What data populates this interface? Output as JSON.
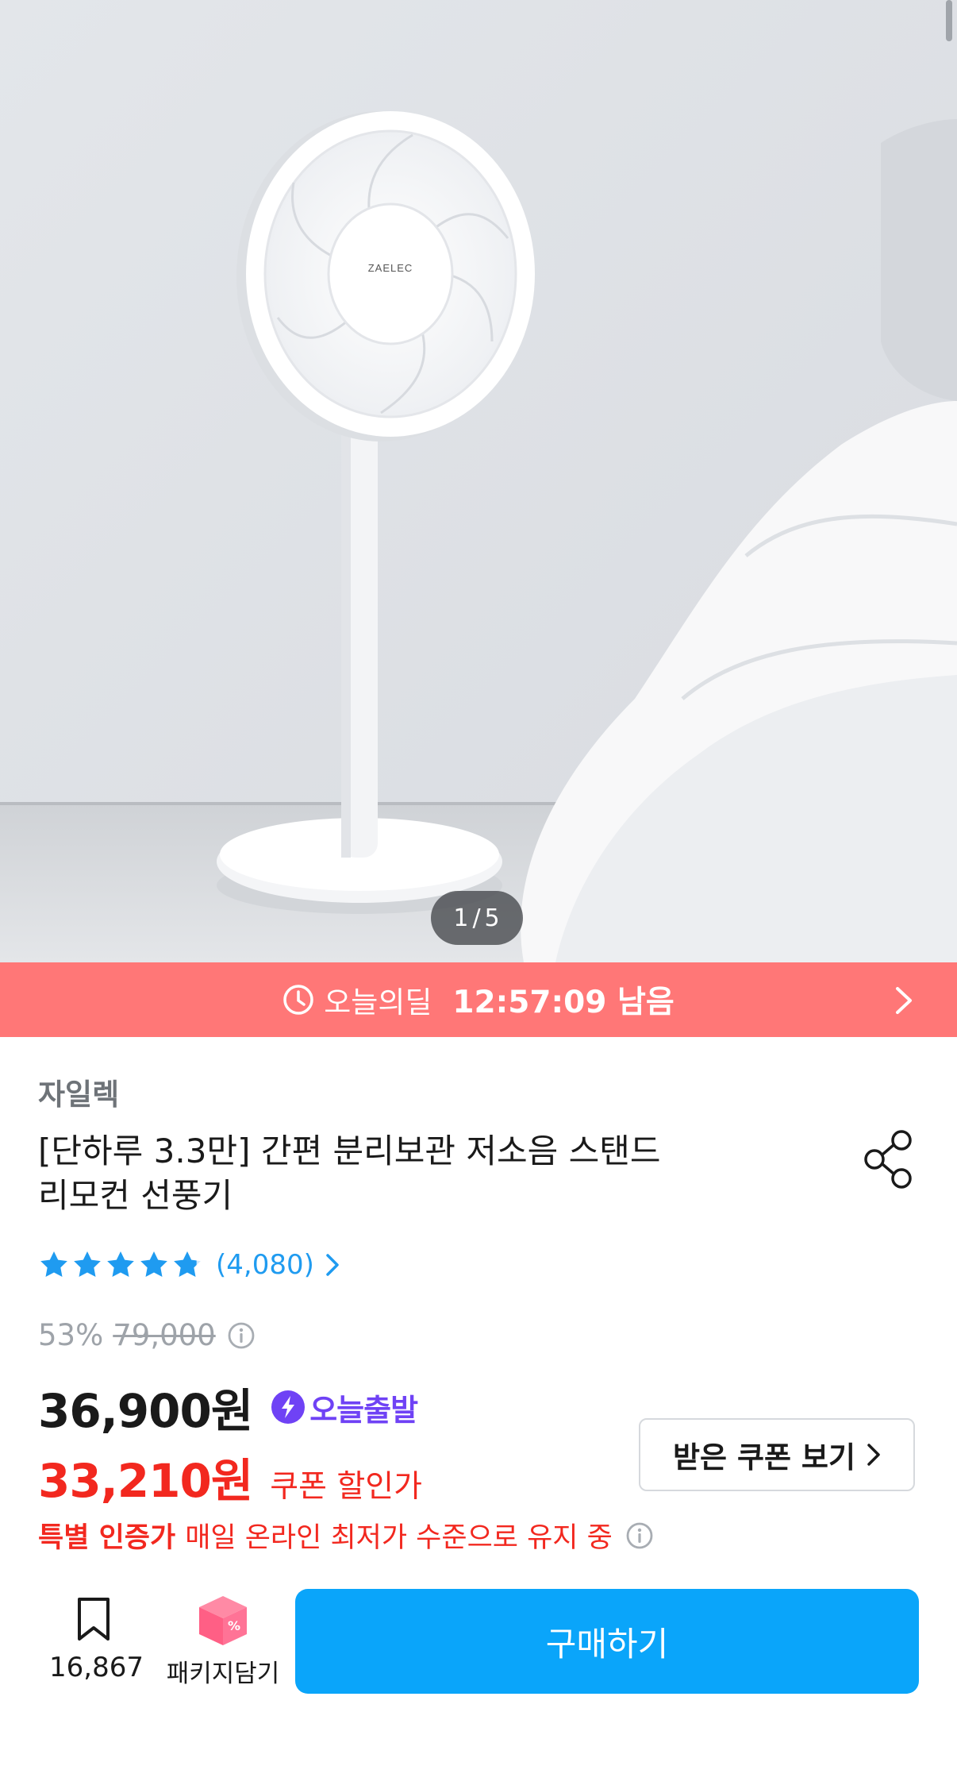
{
  "gallery": {
    "current": "1",
    "total": "5",
    "separator": "/"
  },
  "deal": {
    "label": "오늘의딜",
    "timer": "12:57:09 남음"
  },
  "product": {
    "brand": "자일렉",
    "title_line1": "[단하루 3.3만] 간편 분리보관 저소음 스탠드",
    "title_line2": "리모컨 선풍기",
    "review_count": "(4,080)",
    "rating": 4.8,
    "discount_rate": "53%",
    "original_price": "79,000",
    "price": "36,900원",
    "today_badge": "오늘출발",
    "coupon_price": "33,210원",
    "coupon_label": "쿠폰 할인가",
    "coupon_button": "받은 쿠폰 보기",
    "special_strong": "특별 인증가",
    "special_text": "매일 온라인 최저가 수준으로 유지 중",
    "fan_logo": "ZAELEC"
  },
  "actions": {
    "bookmark_count": "16,867",
    "package_label": "패키지담기",
    "buy_label": "구매하기"
  },
  "colors": {
    "deal_bar": "#ff7777",
    "accent_blue": "#0aa5fa",
    "sale_red": "#f2281f",
    "badge_purple": "#6f42f5",
    "star_blue": "#1f9bf0",
    "package_pink": "#ff6b8a"
  },
  "icons": [
    "clock-icon",
    "chevron-right-icon",
    "share-icon",
    "star-icon",
    "info-icon",
    "lightning-icon",
    "bookmark-icon",
    "package-box-icon"
  ]
}
